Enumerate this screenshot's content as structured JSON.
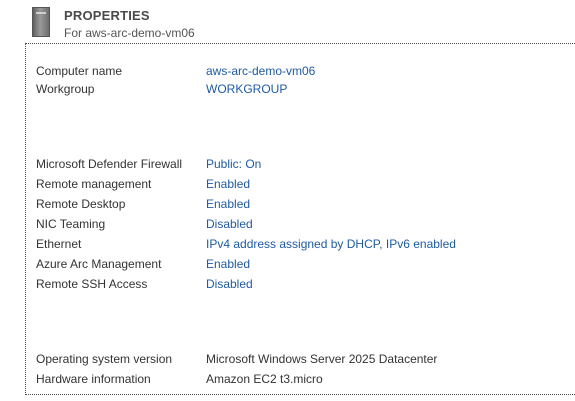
{
  "header": {
    "title": "PROPERTIES",
    "subtitle": "For aws-arc-demo-vm06",
    "icon": "server-icon"
  },
  "colors": {
    "link": "#1e5aa8",
    "text": "#333333"
  },
  "groups": {
    "identity": [
      {
        "label": "Computer name",
        "value": "aws-arc-demo-vm06",
        "link": true
      },
      {
        "label": "Workgroup",
        "value": "WORKGROUP",
        "link": true
      }
    ],
    "network": [
      {
        "label": "Microsoft Defender Firewall",
        "value": "Public: On",
        "link": true
      },
      {
        "label": "Remote management",
        "value": "Enabled",
        "link": true
      },
      {
        "label": "Remote Desktop",
        "value": "Enabled",
        "link": true
      },
      {
        "label": "NIC Teaming",
        "value": "Disabled",
        "link": true
      },
      {
        "label": "Ethernet",
        "value": "IPv4 address assigned by DHCP, IPv6 enabled",
        "link": true
      },
      {
        "label": "Azure Arc Management",
        "value": "Enabled",
        "link": true
      },
      {
        "label": "Remote SSH Access",
        "value": "Disabled",
        "link": true
      }
    ],
    "system": [
      {
        "label": "Operating system version",
        "value": "Microsoft Windows Server 2025 Datacenter",
        "link": false
      },
      {
        "label": "Hardware information",
        "value": "Amazon EC2 t3.micro",
        "link": false
      }
    ]
  }
}
